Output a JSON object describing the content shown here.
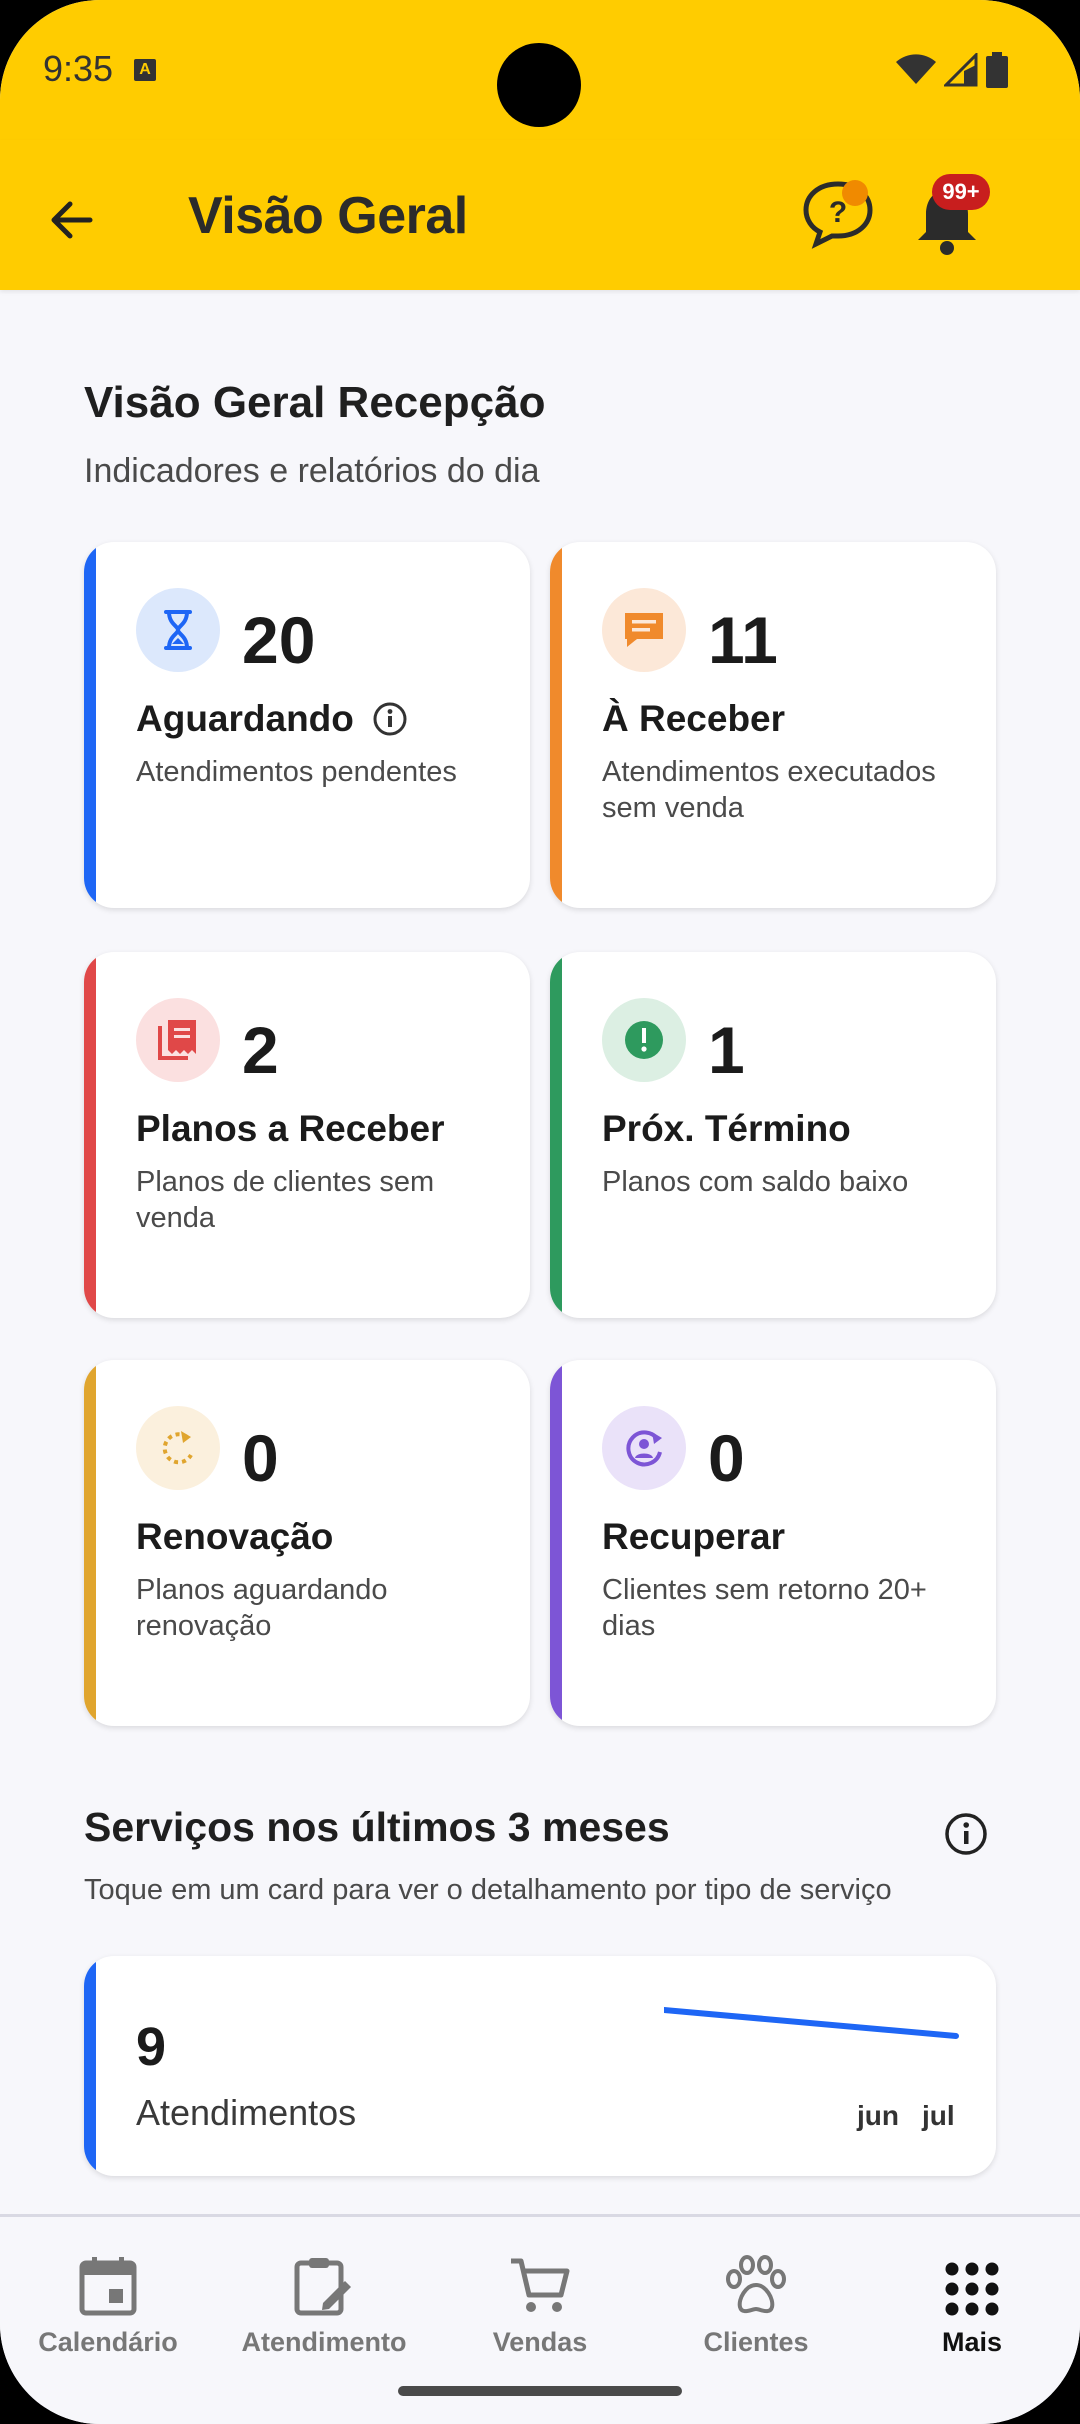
{
  "status_bar": {
    "time": "9:35",
    "a_badge": "A"
  },
  "app_bar": {
    "title": "Visão Geral",
    "notification_badge": "99+"
  },
  "overview": {
    "title": "Visão Geral Recepção",
    "subtitle": "Indicadores e relatórios do dia"
  },
  "cards": [
    {
      "count": "20",
      "label": "Aguardando",
      "desc": "Atendimentos pendentes",
      "accent": "#1E66F5",
      "icon": "hourglass-icon"
    },
    {
      "count": "11",
      "label": "À Receber",
      "desc": "Atendimentos executados sem venda",
      "accent": "#F08A2C",
      "icon": "message-icon"
    },
    {
      "count": "2",
      "label": "Planos a Receber",
      "desc": "Planos de clientes sem venda",
      "accent": "#E04848",
      "icon": "receipt-icon"
    },
    {
      "count": "1",
      "label": "Próx. Término",
      "desc": "Planos com saldo baixo",
      "accent": "#2E9A5E",
      "icon": "alert-icon"
    },
    {
      "count": "0",
      "label": "Renovação",
      "desc": "Planos aguardando renovação",
      "accent": "#E0A52E",
      "icon": "refresh-icon"
    },
    {
      "count": "0",
      "label": "Recuperar",
      "desc": "Clientes sem retorno 20+ dias",
      "accent": "#7D55D6",
      "icon": "person-sync-icon"
    }
  ],
  "services": {
    "title": "Serviços nos últimos 3 meses",
    "subtitle": "Toque em um card para ver o detalhamento por tipo de serviço",
    "card": {
      "count": "9",
      "label": "Atendimentos",
      "months": [
        "jun",
        "jul"
      ]
    }
  },
  "bottom_nav": [
    {
      "label": "Calendário",
      "icon": "calendar-icon",
      "active": false
    },
    {
      "label": "Atendimento",
      "icon": "clipboard-edit-icon",
      "active": false
    },
    {
      "label": "Vendas",
      "icon": "cart-icon",
      "active": false
    },
    {
      "label": "Clientes",
      "icon": "paw-icon",
      "active": false
    },
    {
      "label": "Mais",
      "icon": "grid-dots-icon",
      "active": true
    }
  ],
  "colors": {
    "brand": "#FFCC00",
    "background": "#F7F7FB",
    "badge": "#C81E1E"
  }
}
